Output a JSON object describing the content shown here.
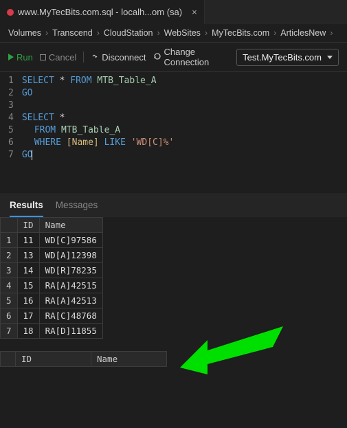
{
  "tab": {
    "title": "www.MyTecBits.com.sql - localh...om (sa)"
  },
  "breadcrumb": {
    "items": [
      "Volumes",
      "Transcend",
      "CloudStation",
      "WebSites",
      "MyTecBits.com",
      "ArticlesNew"
    ]
  },
  "toolbar": {
    "run": "Run",
    "cancel": "Cancel",
    "disconnect": "Disconnect",
    "changeConn": "Change Connection",
    "db": "Test.MyTecBits.com"
  },
  "code": {
    "l1": {
      "select": "SELECT ",
      "star": "*",
      "from": " FROM ",
      "tbl": "MTB_Table_A"
    },
    "l2": {
      "go": "GO"
    },
    "l4": {
      "select": "SELECT ",
      "star": "*"
    },
    "l5": {
      "from": "FROM ",
      "tbl": "MTB_Table_A"
    },
    "l6": {
      "where": "WHERE ",
      "col": "[Name]",
      "like": " LIKE ",
      "lit": "'WD[C]%'"
    },
    "l7": {
      "go": "GO"
    }
  },
  "tabs2": {
    "results": "Results",
    "messages": "Messages"
  },
  "cols": {
    "id": "ID",
    "name": "Name"
  },
  "rows1": [
    {
      "n": "1",
      "id": "11",
      "name": "WD[C]97586"
    },
    {
      "n": "2",
      "id": "13",
      "name": "WD[A]12398"
    },
    {
      "n": "3",
      "id": "14",
      "name": "WD[R]78235"
    },
    {
      "n": "4",
      "id": "15",
      "name": "RA[A]42515"
    },
    {
      "n": "5",
      "id": "16",
      "name": "RA[A]42513"
    },
    {
      "n": "6",
      "id": "17",
      "name": "RA[C]48768"
    },
    {
      "n": "7",
      "id": "18",
      "name": "RA[D]11855"
    }
  ]
}
